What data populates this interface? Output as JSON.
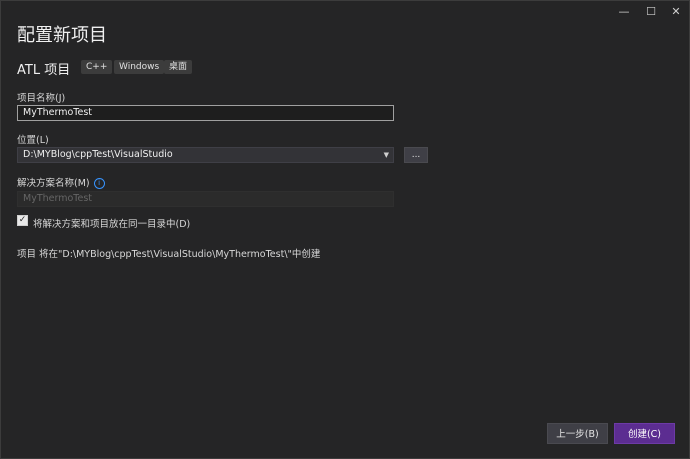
{
  "window": {
    "minimize_glyph": "—",
    "maximize_glyph": "☐",
    "close_glyph": "✕"
  },
  "page": {
    "title": "配置新项目",
    "subtitle": "ATL 项目",
    "tags": [
      "C++",
      "Windows",
      "桌面"
    ]
  },
  "fields": {
    "project_name_label": "项目名称(J)",
    "project_name_value": "MyThermoTest",
    "location_label": "位置(L)",
    "location_value": "D:\\MYBlog\\cppTest\\VisualStudio",
    "browse_label": "...",
    "solution_name_label": "解决方案名称(M)",
    "solution_name_value": "MyThermoTest",
    "same_dir_label": "将解决方案和项目放在同一目录中(D)",
    "same_dir_checked": true
  },
  "summary": "项目 将在\"D:\\MYBlog\\cppTest\\VisualStudio\\MyThermoTest\\\"中创建",
  "buttons": {
    "back_label": "上一步(B)",
    "create_label": "创建(C)"
  },
  "icons": {
    "info": "info-icon",
    "check": "check-icon",
    "dropdown": "chevron-down-icon"
  },
  "colors": {
    "background": "#252526",
    "primary_button": "#5c2d91",
    "info_accent": "#3794ff"
  }
}
